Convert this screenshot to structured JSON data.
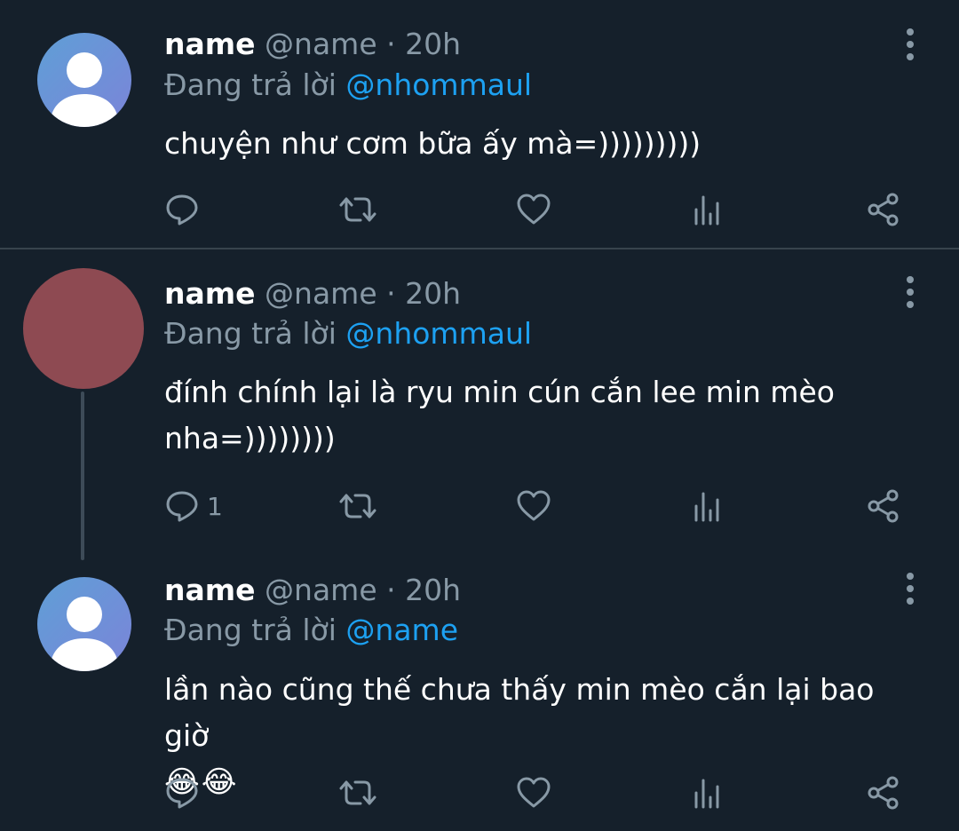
{
  "colors": {
    "background": "#15202b",
    "text_primary": "#ffffff",
    "text_secondary": "#8899a6",
    "mention": "#1da1f2",
    "divider": "#38444d",
    "avatar_blue": "#6b8fd1",
    "avatar_red": "#8e4a52"
  },
  "tweets": [
    {
      "name": "name",
      "handle": "@name",
      "separator": "·",
      "time": "20h",
      "replying_label": "Đang trả lời",
      "replying_to": "@nhommaul",
      "text": "chuyện như cơm bữa ấy mà=)))))))))",
      "reply_count": "",
      "avatar": "default-avatar-icon"
    },
    {
      "name": "name",
      "handle": "@name",
      "separator": "·",
      "time": "20h",
      "replying_label": "Đang trả lời",
      "replying_to": "@nhommaul",
      "text": "đính chính lại là ryu min cún cắn lee min mèo nha=))))))))",
      "reply_count": "1",
      "avatar": "red-avatar"
    },
    {
      "name": "name",
      "handle": "@name",
      "separator": "·",
      "time": "20h",
      "replying_label": "Đang trả lời",
      "replying_to": "@name",
      "text": "lần nào cũng thế chưa thấy min mèo cắn lại bao giờ",
      "emoji": "😂😂",
      "reply_count": "",
      "avatar": "default-avatar-icon"
    }
  ],
  "icons": {
    "reply": "reply-icon",
    "retweet": "retweet-icon",
    "like": "heart-icon",
    "analytics": "analytics-icon",
    "share": "share-icon",
    "more": "more-vertical-icon"
  }
}
